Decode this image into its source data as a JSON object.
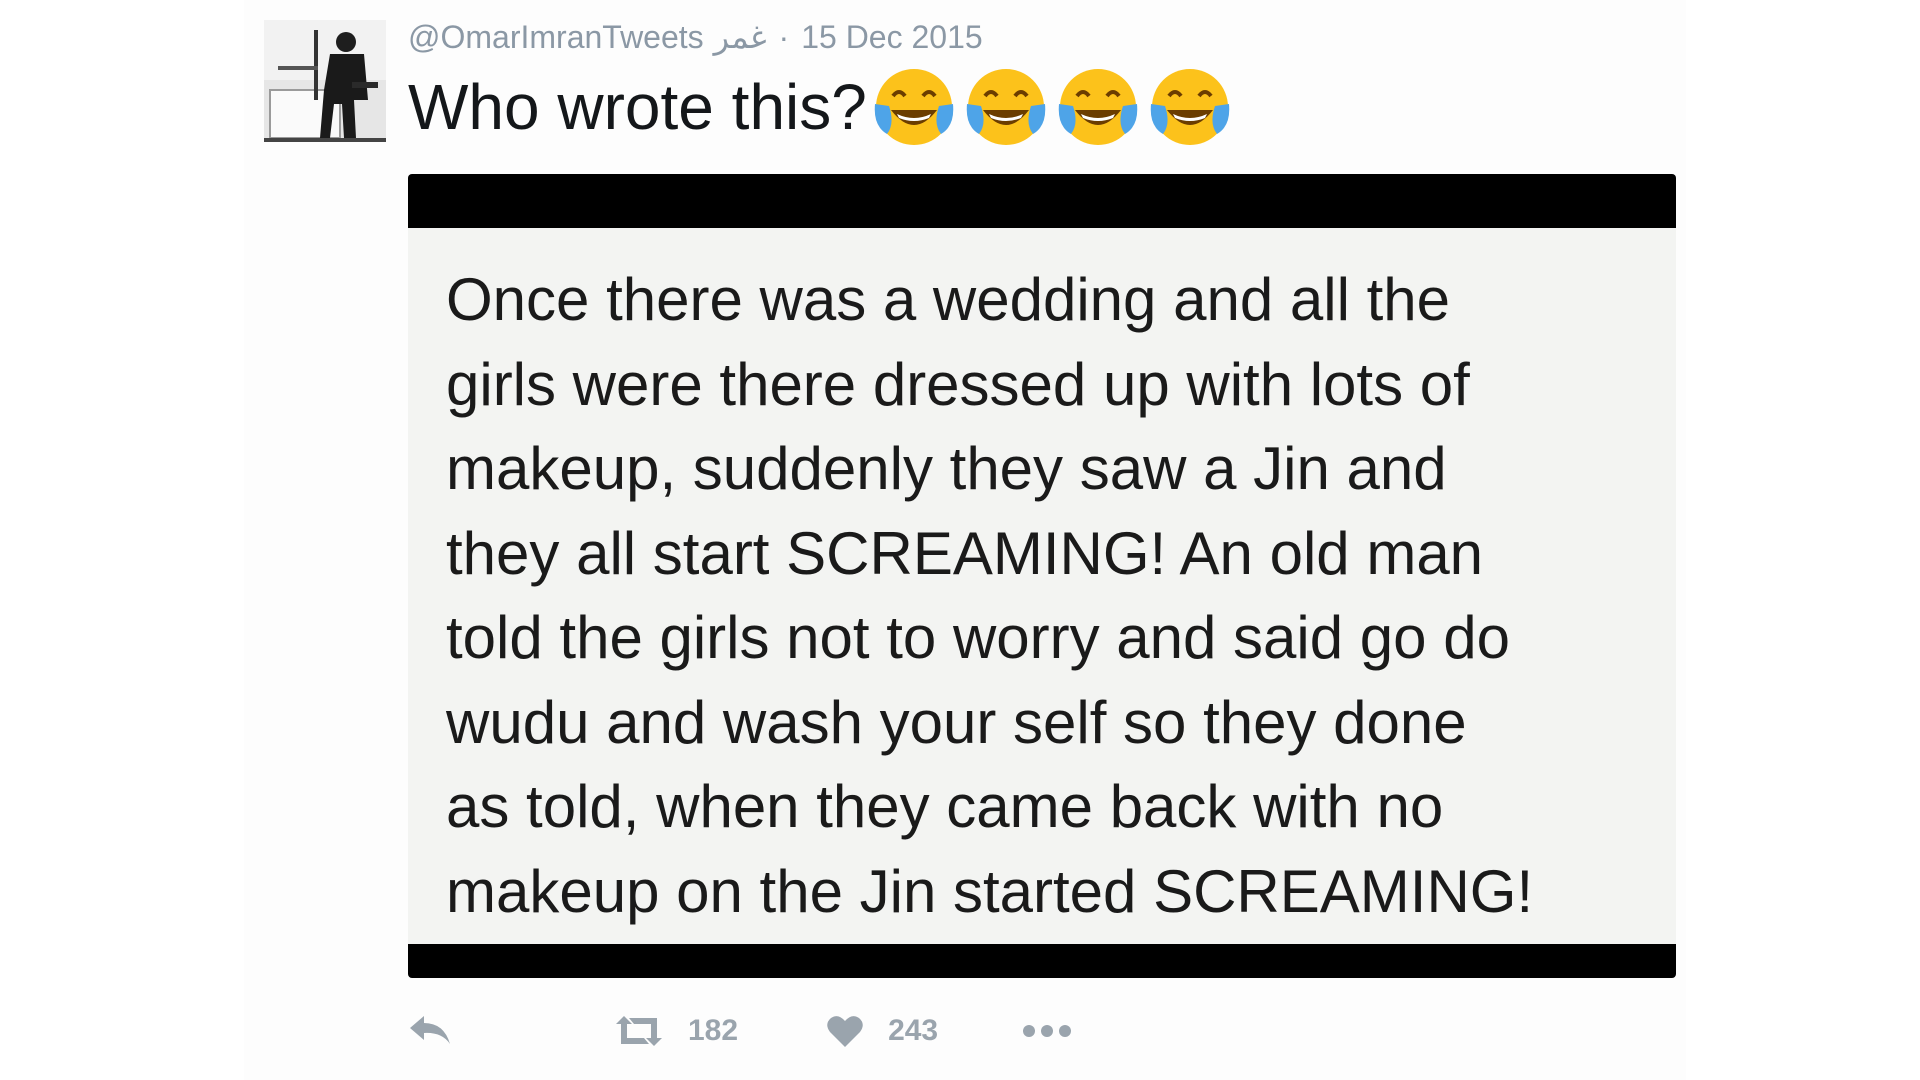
{
  "tweet": {
    "handle": "@OmarImranTweets",
    "name_arabic": "غمر",
    "separator": "·",
    "date": "15 Dec 2015",
    "text": "Who wrote this?",
    "emoji_icon": "face-with-tears-of-joy-icon",
    "emoji_count": 4,
    "image_text": "Once there was a wedding and all the\ngirls were there dressed up with lots of\nmakeup, suddenly they saw a Jin and\nthey all start SCREAMING! An old man\ntold the girls not to worry and said go do\nwudu and wash your self so they done\nas told, when they came back with no\nmakeup on the Jin started SCREAMING!"
  },
  "actions": {
    "reply_icon": "reply-icon",
    "retweet_icon": "retweet-icon",
    "retweet_count": "182",
    "like_icon": "heart-icon",
    "like_count": "243",
    "more_icon": "more-dots-icon"
  },
  "colors": {
    "meta_text": "#8b98a5",
    "action_gray": "#9aa4ad",
    "media_frame": "#000000",
    "media_background": "#f3f4f2",
    "emoji_yellow": "#fcc21b",
    "tear_blue": "#4ea4e8"
  }
}
